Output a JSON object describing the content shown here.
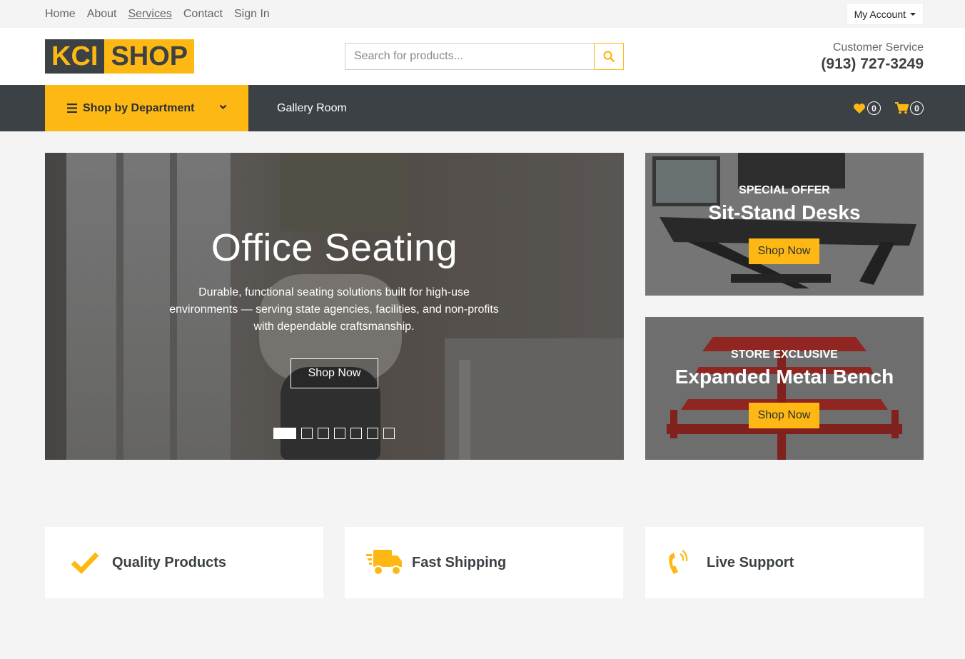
{
  "topnav": {
    "links": [
      "Home",
      "About",
      "Services",
      "Contact",
      "Sign In"
    ],
    "account": "My Account"
  },
  "header": {
    "logo_left": "KCI",
    "logo_right": "SHOP",
    "search_placeholder": "Search for products...",
    "cs_label": "Customer Service",
    "cs_phone": "(913) 727-3249"
  },
  "mainnav": {
    "dept_label": "Shop by Department",
    "gallery_label": "Gallery Room",
    "wishlist_count": "0",
    "cart_count": "0"
  },
  "hero": {
    "title": "Office Seating",
    "description": "Durable, functional seating solutions built for high-use environments — serving state agencies, facilities, and non-profits with dependable craftsmanship.",
    "button": "Shop Now",
    "slides": 7,
    "active_slide": 1
  },
  "promos": [
    {
      "kicker": "SPECIAL OFFER",
      "title": "Sit-Stand Desks",
      "button": "Shop Now"
    },
    {
      "kicker": "STORE EXCLUSIVE",
      "title": "Expanded Metal Bench",
      "button": "Shop Now"
    }
  ],
  "features": [
    {
      "label": "Quality Products",
      "icon": "checkmark-icon"
    },
    {
      "label": "Fast Shipping",
      "icon": "truck-icon"
    },
    {
      "label": "Live Support",
      "icon": "phone-icon"
    }
  ],
  "colors": {
    "accent": "#fdb813",
    "dark": "#3c4145"
  }
}
